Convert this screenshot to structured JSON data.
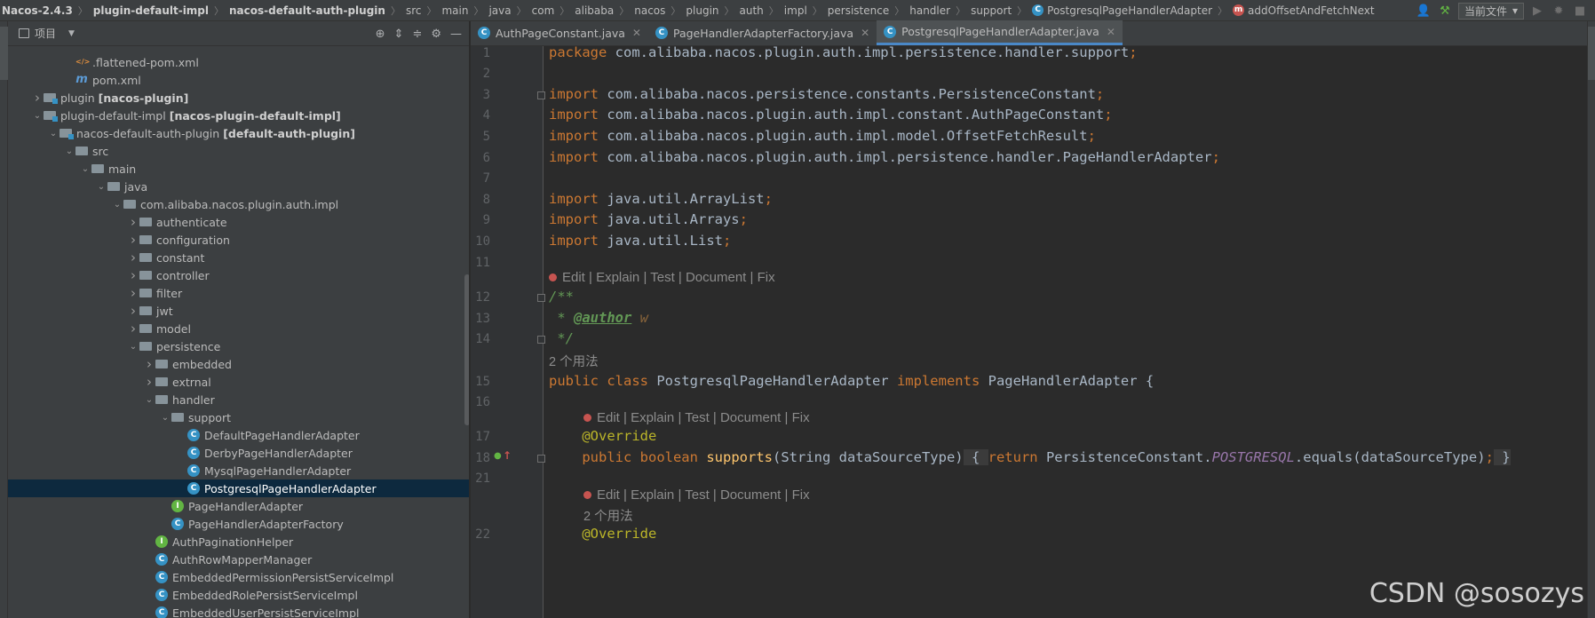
{
  "breadcrumb": [
    {
      "label": "Nacos-2.4.3",
      "bold": true
    },
    {
      "label": "plugin-default-impl",
      "bold": true
    },
    {
      "label": "nacos-default-auth-plugin",
      "bold": true
    },
    {
      "label": "src"
    },
    {
      "label": "main"
    },
    {
      "label": "java"
    },
    {
      "label": "com"
    },
    {
      "label": "alibaba"
    },
    {
      "label": "nacos"
    },
    {
      "label": "plugin"
    },
    {
      "label": "auth"
    },
    {
      "label": "impl"
    },
    {
      "label": "persistence"
    },
    {
      "label": "handler"
    },
    {
      "label": "support"
    },
    {
      "label": "PostgresqlPageHandlerAdapter",
      "icon": "class"
    },
    {
      "label": "addOffsetAndFetchNext",
      "icon": "method"
    }
  ],
  "run_config": {
    "label": "当前文件"
  },
  "project_panel": {
    "title": "项目"
  },
  "tree": [
    {
      "label": ".flattened-pom.xml",
      "indent": 3,
      "icon": "xml",
      "arrow": ""
    },
    {
      "label": "pom.xml",
      "indent": 3,
      "icon": "m",
      "arrow": ""
    },
    {
      "label": "plugin",
      "suffix": "[nacos-plugin]",
      "indent": 1,
      "icon": "module",
      "arrow": "right"
    },
    {
      "label": "plugin-default-impl",
      "suffix": "[nacos-plugin-default-impl]",
      "indent": 1,
      "icon": "module",
      "arrow": "down"
    },
    {
      "label": "nacos-default-auth-plugin",
      "suffix": "[default-auth-plugin]",
      "indent": 2,
      "icon": "module",
      "arrow": "down"
    },
    {
      "label": "src",
      "indent": 3,
      "icon": "folder",
      "arrow": "down"
    },
    {
      "label": "main",
      "indent": 4,
      "icon": "folder",
      "arrow": "down"
    },
    {
      "label": "java",
      "indent": 5,
      "icon": "folder",
      "arrow": "down"
    },
    {
      "label": "com.alibaba.nacos.plugin.auth.impl",
      "indent": 6,
      "icon": "folder",
      "arrow": "down"
    },
    {
      "label": "authenticate",
      "indent": 7,
      "icon": "folder",
      "arrow": "right"
    },
    {
      "label": "configuration",
      "indent": 7,
      "icon": "folder",
      "arrow": "right"
    },
    {
      "label": "constant",
      "indent": 7,
      "icon": "folder",
      "arrow": "right"
    },
    {
      "label": "controller",
      "indent": 7,
      "icon": "folder",
      "arrow": "right"
    },
    {
      "label": "filter",
      "indent": 7,
      "icon": "folder",
      "arrow": "right"
    },
    {
      "label": "jwt",
      "indent": 7,
      "icon": "folder",
      "arrow": "right"
    },
    {
      "label": "model",
      "indent": 7,
      "icon": "folder",
      "arrow": "right"
    },
    {
      "label": "persistence",
      "indent": 7,
      "icon": "folder",
      "arrow": "down"
    },
    {
      "label": "embedded",
      "indent": 8,
      "icon": "folder",
      "arrow": "right"
    },
    {
      "label": "extrnal",
      "indent": 8,
      "icon": "folder",
      "arrow": "right"
    },
    {
      "label": "handler",
      "indent": 8,
      "icon": "folder",
      "arrow": "down"
    },
    {
      "label": "support",
      "indent": 9,
      "icon": "folder",
      "arrow": "down"
    },
    {
      "label": "DefaultPageHandlerAdapter",
      "indent": 10,
      "icon": "class",
      "arrow": ""
    },
    {
      "label": "DerbyPageHandlerAdapter",
      "indent": 10,
      "icon": "class",
      "arrow": ""
    },
    {
      "label": "MysqlPageHandlerAdapter",
      "indent": 10,
      "icon": "class",
      "arrow": ""
    },
    {
      "label": "PostgresqlPageHandlerAdapter",
      "indent": 10,
      "icon": "class",
      "arrow": "",
      "selected": true
    },
    {
      "label": "PageHandlerAdapter",
      "indent": 9,
      "icon": "interface",
      "arrow": ""
    },
    {
      "label": "PageHandlerAdapterFactory",
      "indent": 9,
      "icon": "class",
      "arrow": ""
    },
    {
      "label": "AuthPaginationHelper",
      "indent": 8,
      "icon": "interface",
      "arrow": ""
    },
    {
      "label": "AuthRowMapperManager",
      "indent": 8,
      "icon": "class",
      "arrow": ""
    },
    {
      "label": "EmbeddedPermissionPersistServiceImpl",
      "indent": 8,
      "icon": "class",
      "arrow": ""
    },
    {
      "label": "EmbeddedRolePersistServiceImpl",
      "indent": 8,
      "icon": "class",
      "arrow": ""
    },
    {
      "label": "EmbeddedUserPersistServiceImpl",
      "indent": 8,
      "icon": "class",
      "arrow": ""
    }
  ],
  "tabs": [
    {
      "label": "AuthPageConstant.java",
      "active": false
    },
    {
      "label": "PageHandlerAdapterFactory.java",
      "active": false
    },
    {
      "label": "PostgresqlPageHandlerAdapter.java",
      "active": true
    }
  ],
  "code_lines": [
    {
      "num": "1",
      "html": "<span class='kw'>package</span> com.alibaba.nacos.plugin.auth.impl.persistence.handler.support<span class='kw'>;</span>"
    },
    {
      "num": "2",
      "html": ""
    },
    {
      "num": "3",
      "html": "<span class='kw'>import</span> com.alibaba.nacos.persistence.constants.PersistenceConstant<span class='kw'>;</span>"
    },
    {
      "num": "4",
      "html": "<span class='kw'>import</span> com.alibaba.nacos.plugin.auth.impl.constant.AuthPageConstant<span class='kw'>;</span>"
    },
    {
      "num": "5",
      "html": "<span class='kw'>import</span> com.alibaba.nacos.plugin.auth.impl.model.OffsetFetchResult<span class='kw'>;</span>"
    },
    {
      "num": "6",
      "html": "<span class='kw'>import</span> com.alibaba.nacos.plugin.auth.impl.persistence.handler.PageHandlerAdapter<span class='kw'>;</span>"
    },
    {
      "num": "7",
      "html": ""
    },
    {
      "num": "8",
      "html": "<span class='kw'>import</span> java.util.ArrayList<span class='kw'>;</span>"
    },
    {
      "num": "9",
      "html": "<span class='kw'>import</span> java.util.Arrays<span class='kw'>;</span>"
    },
    {
      "num": "10",
      "html": "<span class='kw'>import</span> java.util.List<span class='kw'>;</span>"
    },
    {
      "num": "11",
      "html": ""
    },
    {
      "num": "12",
      "html": "<span class='doc'>/**</span>"
    },
    {
      "num": "13",
      "html": "<span class='doc'> * </span><span class='doc-tag'>@author</span><span class='doc-val'> w</span>"
    },
    {
      "num": "14",
      "html": "<span class='doc'> */</span>"
    },
    {
      "num": "15",
      "html": "<span class='kw'>public class</span> PostgresqlPageHandlerAdapter <span class='kw'>implements</span> PageHandlerAdapter {"
    },
    {
      "num": "16",
      "html": ""
    },
    {
      "num": "17",
      "html": "    <span class='ann'>@Override</span>"
    },
    {
      "num": "18",
      "html": "    <span class='kw'>public boolean</span> <span class='fn'>supports</span>(String dataSourceType)<span class='fold-box'> { </span><span class='kw'>return</span> PersistenceConstant.<span class='static'>POSTGRESQL</span>.equals(dataSourceType)<span class='kw'>;</span><span class='fold-box'> }</span>"
    },
    {
      "num": "21",
      "html": ""
    },
    {
      "num": "22",
      "html": "    <span class='ann'>@Override</span>"
    }
  ],
  "code_hints": [
    {
      "text": "Edit | Explain | Test | Document | Fix"
    },
    {
      "text": "Edit | Explain | Test | Document | Fix"
    },
    {
      "text": "Edit | Explain | Test | Document | Fix"
    }
  ],
  "usages": [
    {
      "text": "2 个用法"
    },
    {
      "text": "2 个用法"
    }
  ],
  "watermark": "CSDN @sosozys",
  "colors": {
    "background": "#2b2b2b",
    "panel": "#3c3f41",
    "selection": "#0d293e",
    "keyword": "#cc7832",
    "annotation": "#bbb529",
    "function": "#ffc66d",
    "doc": "#629755",
    "constant": "#9876aa",
    "class_icon": "#3592c4",
    "interface_icon": "#62b543",
    "method_icon": "#c75450"
  }
}
